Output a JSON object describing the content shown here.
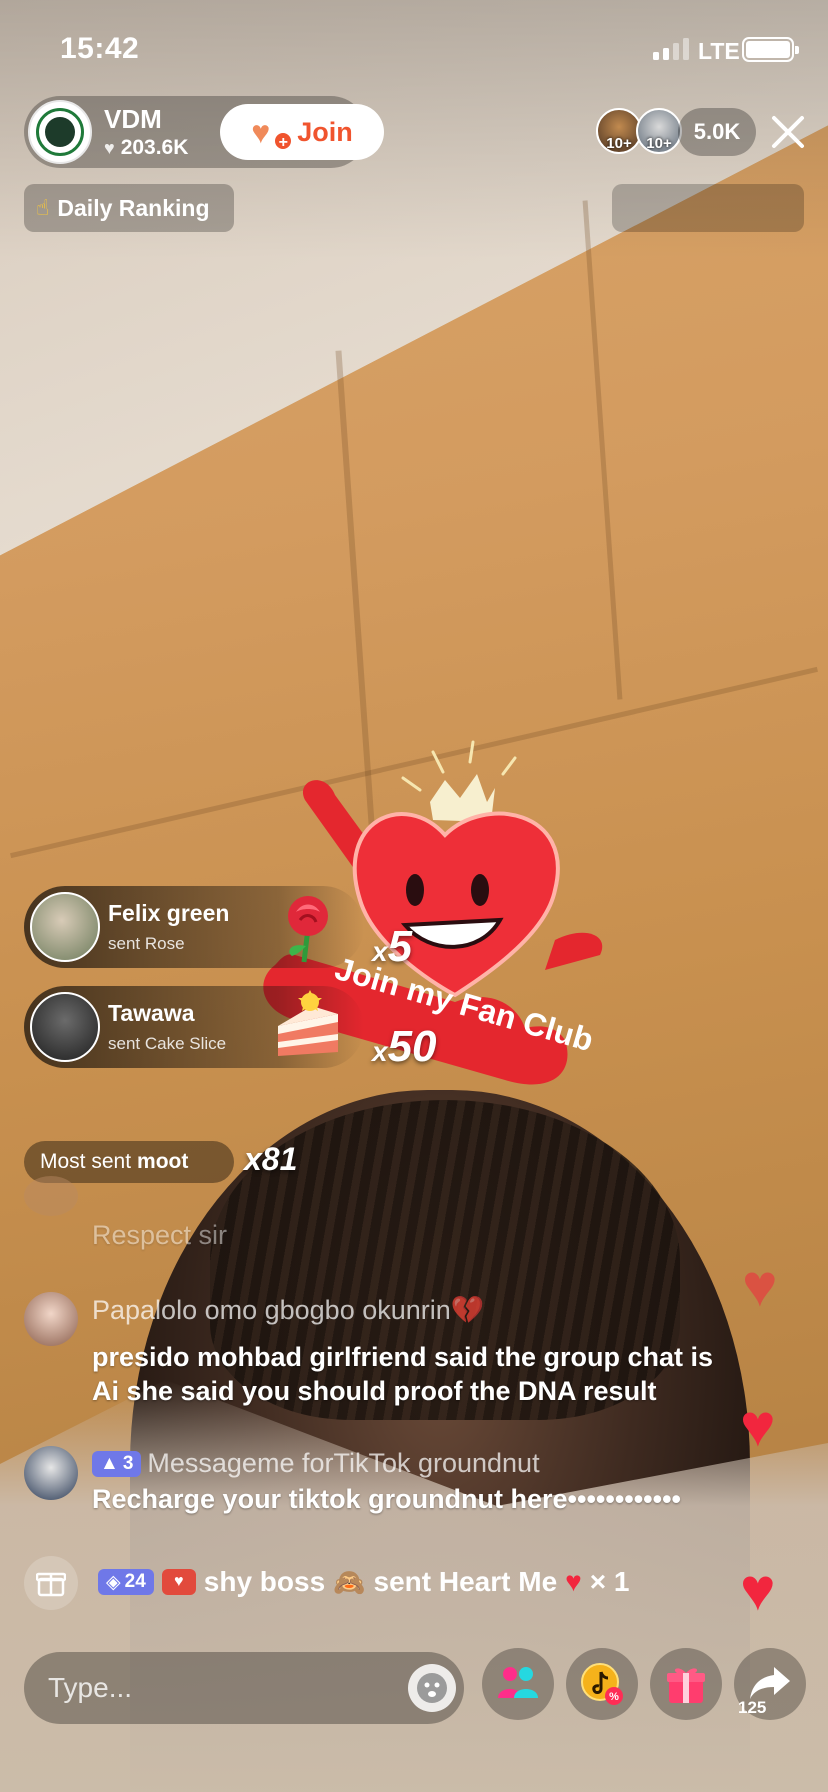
{
  "status_bar": {
    "time": "15:42",
    "network": "LTE"
  },
  "host": {
    "name": "VDM",
    "likes": "203.6K",
    "join_label": "Join"
  },
  "viewers": {
    "badge_1": "10+",
    "badge_2": "10+",
    "count": "5.0K"
  },
  "ranking": {
    "label": "Daily Ranking"
  },
  "gifts": [
    {
      "user": "Felix green",
      "action": "sent Rose",
      "x": "x",
      "count": "5"
    },
    {
      "user": "Tawawa",
      "action": "sent Cake Slice",
      "x": "x",
      "count": "50"
    }
  ],
  "most_sent": {
    "label": "Most sent",
    "gift": "moot",
    "count": "x81"
  },
  "comments": [
    {
      "user": "",
      "text": "Respect sir",
      "faded": true
    },
    {
      "user": "Papalolo omo gbogbo okunrin💔",
      "text_1": "presido mohbad girlfriend said the group chat is",
      "text_2": "Ai she said you should proof the DNA result"
    },
    {
      "level": "3",
      "user": "Messageme forTikTok groundnut",
      "text": "Recharge your tiktok groundnut here••••••••••••"
    }
  ],
  "ticker": {
    "level": "24",
    "user": "shy boss",
    "action": "sent Heart Me",
    "times": "× 1"
  },
  "bottom_bar": {
    "placeholder": "Type...",
    "share_count": "125"
  },
  "sticker": {
    "text": "Join my Fan Club"
  },
  "colors": {
    "accent": "#f0542e",
    "heart": "#f2263e",
    "level_badge": "#6f78e8"
  }
}
